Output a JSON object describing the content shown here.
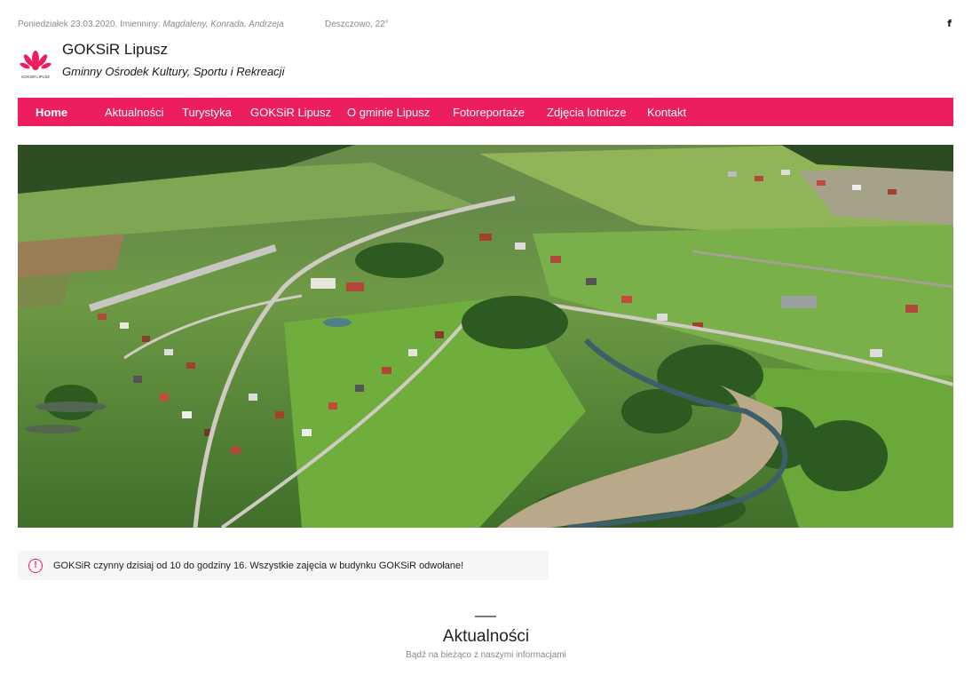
{
  "topbar": {
    "date_label": "Poniedziałek 23.03.2020. Imienniny: ",
    "namedays": "Magdaleny, Konrada, Andrzeja",
    "weather": "Deszczowo, 22°",
    "facebook_icon": "facebook-icon",
    "facebook_glyph": "f"
  },
  "brand": {
    "logo_text": "GOKSiR LIPUSZ",
    "title": "GOKSiR Lipusz",
    "subtitle": "Gminny Ośrodek Kultury, Sportu i Rekreacji"
  },
  "nav": {
    "items": [
      {
        "label": "Home",
        "active": true
      },
      {
        "label": "Aktualności"
      },
      {
        "label": "Turystyka"
      },
      {
        "label": "GOKSiR Lipusz"
      },
      {
        "label": "O gminie Lipusz"
      },
      {
        "label": "Fotoreportaże"
      },
      {
        "label": "Zdjęcia lotnicze"
      },
      {
        "label": "Kontakt"
      }
    ]
  },
  "notice": {
    "icon": "info-icon",
    "icon_glyph": "!",
    "text": "GOKSiR czynny dzisiaj od 10 do godziny 16. Wszystkie zajęcia w budynku GOKSiR odwołane!"
  },
  "section": {
    "title": "Aktualności",
    "subtitle": "Bądź na bieżąco z naszymi informacjami"
  },
  "colors": {
    "accent": "#ed1e5f",
    "nav_text": "#ffffff",
    "notice_bg": "#f6f6f6"
  }
}
